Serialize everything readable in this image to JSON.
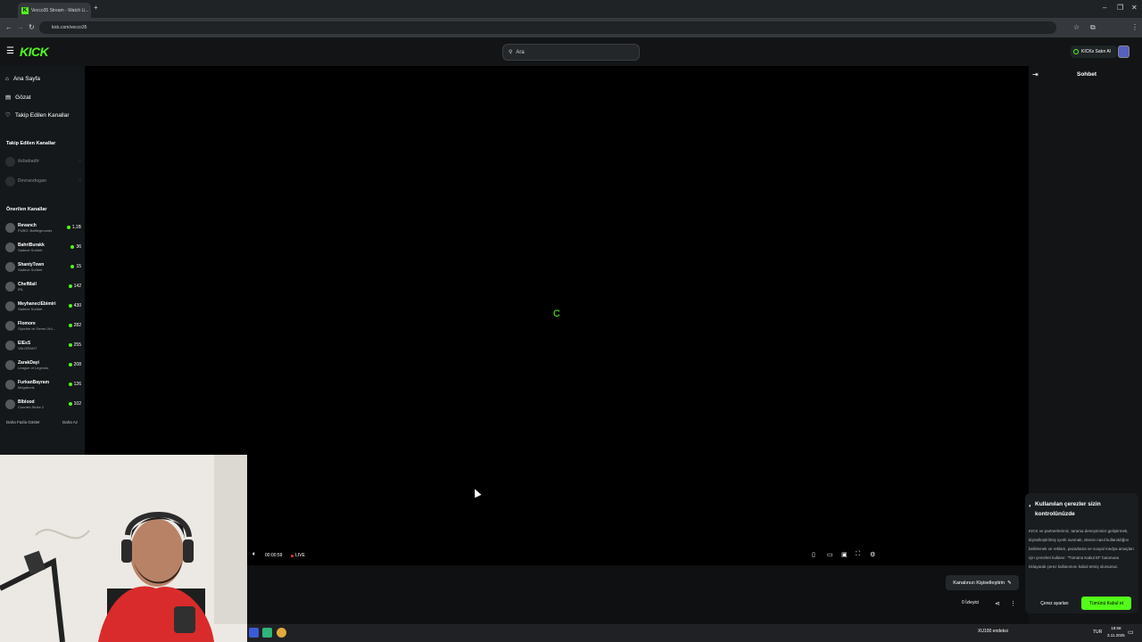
{
  "browser": {
    "tab_title": "Vecco35 Stream - Watch Li...",
    "url": "kick.com/vecco35"
  },
  "header": {
    "logo": "KICK",
    "search_placeholder": "Ara",
    "kicks_label": "KICKs Satın Al"
  },
  "sidebar": {
    "nav": [
      {
        "label": "Ana Sayfa",
        "icon": "home-icon"
      },
      {
        "label": "Gözat",
        "icon": "browse-icon"
      },
      {
        "label": "Takip Edilen Kanallar",
        "icon": "heart-icon"
      }
    ],
    "followed_title": "Takip Edilen Kanallar",
    "followed": [
      {
        "name": "itsbahadir",
        "viewers": ""
      },
      {
        "name": "Devrandogan",
        "viewers": ""
      }
    ],
    "recommended_title": "Önerilen Kanallar",
    "recommended": [
      {
        "name": "Revanch",
        "category": "PUBG: Battlegrounds",
        "viewers": "1,1B"
      },
      {
        "name": "BahriBurakk",
        "category": "Sadece Sohbet",
        "viewers": "36"
      },
      {
        "name": "ShantyTown",
        "category": "Sadece Sohbet",
        "viewers": "15"
      },
      {
        "name": "ChefMail",
        "category": "IRL",
        "viewers": "142"
      },
      {
        "name": "MeyhaneciEbimiri",
        "category": "Sadece Sohbet",
        "viewers": "430"
      },
      {
        "name": "Flomore",
        "category": "Oyunlar ve Demo Ürü...",
        "viewers": "282"
      },
      {
        "name": "ElEsS",
        "category": "VALORANT",
        "viewers": "255"
      },
      {
        "name": "ZarakDayi",
        "category": "League of Legends",
        "viewers": "208"
      },
      {
        "name": "FurkanBayram",
        "category": "Megabonk",
        "viewers": "126"
      },
      {
        "name": "Blblood",
        "category": "Counter-Strike 2",
        "viewers": "102"
      }
    ],
    "show_more": "Daha Fazla Göster",
    "show_less": "Daha Az"
  },
  "player": {
    "time": "00:00:59",
    "live_label": "LIVE",
    "spinner": "C"
  },
  "below_player": {
    "customize_label": "Kanalınızı Kişiselleştirin",
    "viewers_label": "0 İzleyici"
  },
  "chat": {
    "title": "Sohbet"
  },
  "cookie": {
    "title": "Kullanılan çerezler sizin kontrolünüzde",
    "body": "KICK ve partnerlerimiz, tarama deneyiminizi geliştirmek, kişiselleştirilmiş içerik sunmak, sitenin nasıl kullanıldığını belirlemek ve reklam, pazarlama ve sosyal medya amaçları için çerezleri kullanır. \"Tümünü Kabul Et\" butonuna tıklayarak çerez kullanımını kabul etmiş olursunuz.",
    "settings_label": "Çerez ayarları",
    "accept_label": "Tümünü Kabul et"
  },
  "taskbar": {
    "weather": "XU100 endeksi",
    "lang": "TUR",
    "time": "18:58",
    "date": "3.11.2025"
  },
  "colors": {
    "accent": "#53fc18",
    "background": "#000000"
  }
}
